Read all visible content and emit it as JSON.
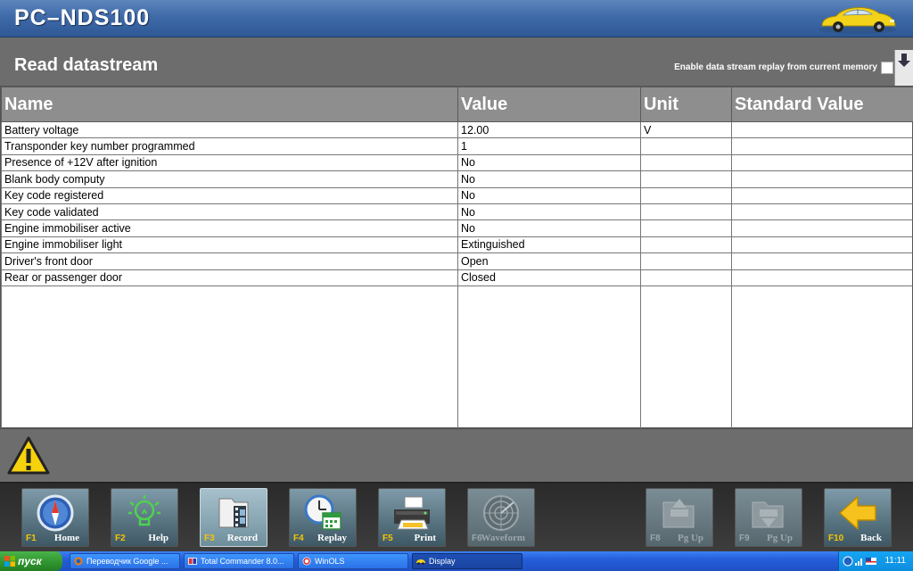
{
  "app": {
    "title": "PC–NDS100"
  },
  "page": {
    "title": "Read datastream",
    "replay_label": "Enable data stream replay from current memory"
  },
  "table": {
    "headers": [
      "Name",
      "Value",
      "Unit",
      "Standard Value"
    ],
    "rows": [
      [
        "Battery voltage",
        "12.00",
        "V",
        ""
      ],
      [
        "Transponder key number programmed",
        "1",
        "",
        ""
      ],
      [
        "Presence of +12V after ignition",
        "No",
        "",
        ""
      ],
      [
        "Blank body computy",
        "No",
        "",
        ""
      ],
      [
        "Key code registered",
        "No",
        "",
        ""
      ],
      [
        "Key code validated",
        "No",
        "",
        ""
      ],
      [
        "Engine immobiliser active",
        "No",
        "",
        ""
      ],
      [
        "Engine immobiliser light",
        "Extinguished",
        "",
        ""
      ],
      [
        "Driver's front door",
        "Open",
        "",
        ""
      ],
      [
        "Rear or passenger door",
        "Closed",
        "",
        ""
      ]
    ]
  },
  "function_bar": {
    "buttons": [
      {
        "key": "F1",
        "label": "Home",
        "icon": "compass-icon"
      },
      {
        "key": "F2",
        "label": "Help",
        "icon": "lightbulb-icon"
      },
      {
        "key": "F3",
        "label": "Record",
        "icon": "film-folder-icon"
      },
      {
        "key": "F4",
        "label": "Replay",
        "icon": "clock-calendar-icon"
      },
      {
        "key": "F5",
        "label": "Print",
        "icon": "printer-icon"
      },
      {
        "key": "F6",
        "label": "Waveform",
        "icon": "radar-icon"
      },
      {
        "key": "F8",
        "label": "Pg Up",
        "icon": "folder-up-icon"
      },
      {
        "key": "F9",
        "label": "Pg Up",
        "icon": "folder-down-icon"
      },
      {
        "key": "F10",
        "label": "Back",
        "icon": "arrow-left-icon"
      }
    ]
  },
  "taskbar": {
    "start_label": "пуск",
    "tasks": [
      {
        "label": "Переводчик Google ..."
      },
      {
        "label": "Total Commander 8.0..."
      },
      {
        "label": "WinOLS"
      },
      {
        "label": "Display"
      }
    ],
    "clock": "11:11"
  },
  "colors": {
    "header_blue": "#3f6aa8",
    "panel_gray": "#6d6d6d",
    "fkey_yellow": "#f7c400",
    "taskbar_blue": "#245edb",
    "start_green": "#2e932e"
  }
}
